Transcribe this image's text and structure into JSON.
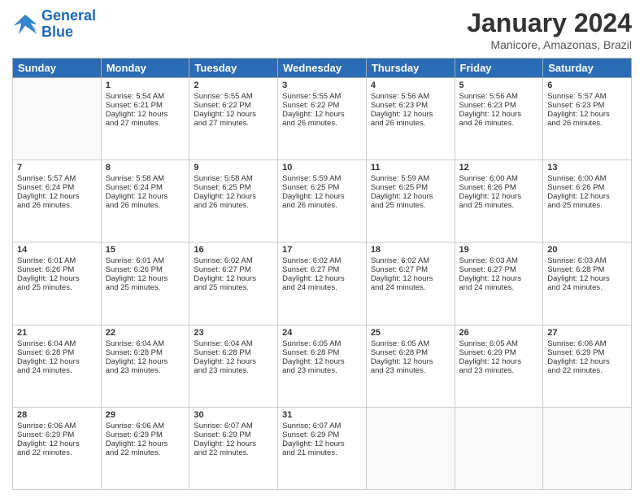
{
  "header": {
    "logo_line1": "General",
    "logo_line2": "Blue",
    "month": "January 2024",
    "location": "Manicore, Amazonas, Brazil"
  },
  "days_of_week": [
    "Sunday",
    "Monday",
    "Tuesday",
    "Wednesday",
    "Thursday",
    "Friday",
    "Saturday"
  ],
  "weeks": [
    [
      {
        "num": "",
        "info": ""
      },
      {
        "num": "1",
        "info": "Sunrise: 5:54 AM\nSunset: 6:21 PM\nDaylight: 12 hours\nand 27 minutes."
      },
      {
        "num": "2",
        "info": "Sunrise: 5:55 AM\nSunset: 6:22 PM\nDaylight: 12 hours\nand 27 minutes."
      },
      {
        "num": "3",
        "info": "Sunrise: 5:55 AM\nSunset: 6:22 PM\nDaylight: 12 hours\nand 26 minutes."
      },
      {
        "num": "4",
        "info": "Sunrise: 5:56 AM\nSunset: 6:23 PM\nDaylight: 12 hours\nand 26 minutes."
      },
      {
        "num": "5",
        "info": "Sunrise: 5:56 AM\nSunset: 6:23 PM\nDaylight: 12 hours\nand 26 minutes."
      },
      {
        "num": "6",
        "info": "Sunrise: 5:57 AM\nSunset: 6:23 PM\nDaylight: 12 hours\nand 26 minutes."
      }
    ],
    [
      {
        "num": "7",
        "info": "Sunrise: 5:57 AM\nSunset: 6:24 PM\nDaylight: 12 hours\nand 26 minutes."
      },
      {
        "num": "8",
        "info": "Sunrise: 5:58 AM\nSunset: 6:24 PM\nDaylight: 12 hours\nand 26 minutes."
      },
      {
        "num": "9",
        "info": "Sunrise: 5:58 AM\nSunset: 6:25 PM\nDaylight: 12 hours\nand 26 minutes."
      },
      {
        "num": "10",
        "info": "Sunrise: 5:59 AM\nSunset: 6:25 PM\nDaylight: 12 hours\nand 26 minutes."
      },
      {
        "num": "11",
        "info": "Sunrise: 5:59 AM\nSunset: 6:25 PM\nDaylight: 12 hours\nand 25 minutes."
      },
      {
        "num": "12",
        "info": "Sunrise: 6:00 AM\nSunset: 6:26 PM\nDaylight: 12 hours\nand 25 minutes."
      },
      {
        "num": "13",
        "info": "Sunrise: 6:00 AM\nSunset: 6:26 PM\nDaylight: 12 hours\nand 25 minutes."
      }
    ],
    [
      {
        "num": "14",
        "info": "Sunrise: 6:01 AM\nSunset: 6:26 PM\nDaylight: 12 hours\nand 25 minutes."
      },
      {
        "num": "15",
        "info": "Sunrise: 6:01 AM\nSunset: 6:26 PM\nDaylight: 12 hours\nand 25 minutes."
      },
      {
        "num": "16",
        "info": "Sunrise: 6:02 AM\nSunset: 6:27 PM\nDaylight: 12 hours\nand 25 minutes."
      },
      {
        "num": "17",
        "info": "Sunrise: 6:02 AM\nSunset: 6:27 PM\nDaylight: 12 hours\nand 24 minutes."
      },
      {
        "num": "18",
        "info": "Sunrise: 6:02 AM\nSunset: 6:27 PM\nDaylight: 12 hours\nand 24 minutes."
      },
      {
        "num": "19",
        "info": "Sunrise: 6:03 AM\nSunset: 6:27 PM\nDaylight: 12 hours\nand 24 minutes."
      },
      {
        "num": "20",
        "info": "Sunrise: 6:03 AM\nSunset: 6:28 PM\nDaylight: 12 hours\nand 24 minutes."
      }
    ],
    [
      {
        "num": "21",
        "info": "Sunrise: 6:04 AM\nSunset: 6:28 PM\nDaylight: 12 hours\nand 24 minutes."
      },
      {
        "num": "22",
        "info": "Sunrise: 6:04 AM\nSunset: 6:28 PM\nDaylight: 12 hours\nand 23 minutes."
      },
      {
        "num": "23",
        "info": "Sunrise: 6:04 AM\nSunset: 6:28 PM\nDaylight: 12 hours\nand 23 minutes."
      },
      {
        "num": "24",
        "info": "Sunrise: 6:05 AM\nSunset: 6:28 PM\nDaylight: 12 hours\nand 23 minutes."
      },
      {
        "num": "25",
        "info": "Sunrise: 6:05 AM\nSunset: 6:28 PM\nDaylight: 12 hours\nand 23 minutes."
      },
      {
        "num": "26",
        "info": "Sunrise: 6:05 AM\nSunset: 6:29 PM\nDaylight: 12 hours\nand 23 minutes."
      },
      {
        "num": "27",
        "info": "Sunrise: 6:06 AM\nSunset: 6:29 PM\nDaylight: 12 hours\nand 22 minutes."
      }
    ],
    [
      {
        "num": "28",
        "info": "Sunrise: 6:06 AM\nSunset: 6:29 PM\nDaylight: 12 hours\nand 22 minutes."
      },
      {
        "num": "29",
        "info": "Sunrise: 6:06 AM\nSunset: 6:29 PM\nDaylight: 12 hours\nand 22 minutes."
      },
      {
        "num": "30",
        "info": "Sunrise: 6:07 AM\nSunset: 6:29 PM\nDaylight: 12 hours\nand 22 minutes."
      },
      {
        "num": "31",
        "info": "Sunrise: 6:07 AM\nSunset: 6:29 PM\nDaylight: 12 hours\nand 21 minutes."
      },
      {
        "num": "",
        "info": ""
      },
      {
        "num": "",
        "info": ""
      },
      {
        "num": "",
        "info": ""
      }
    ]
  ]
}
